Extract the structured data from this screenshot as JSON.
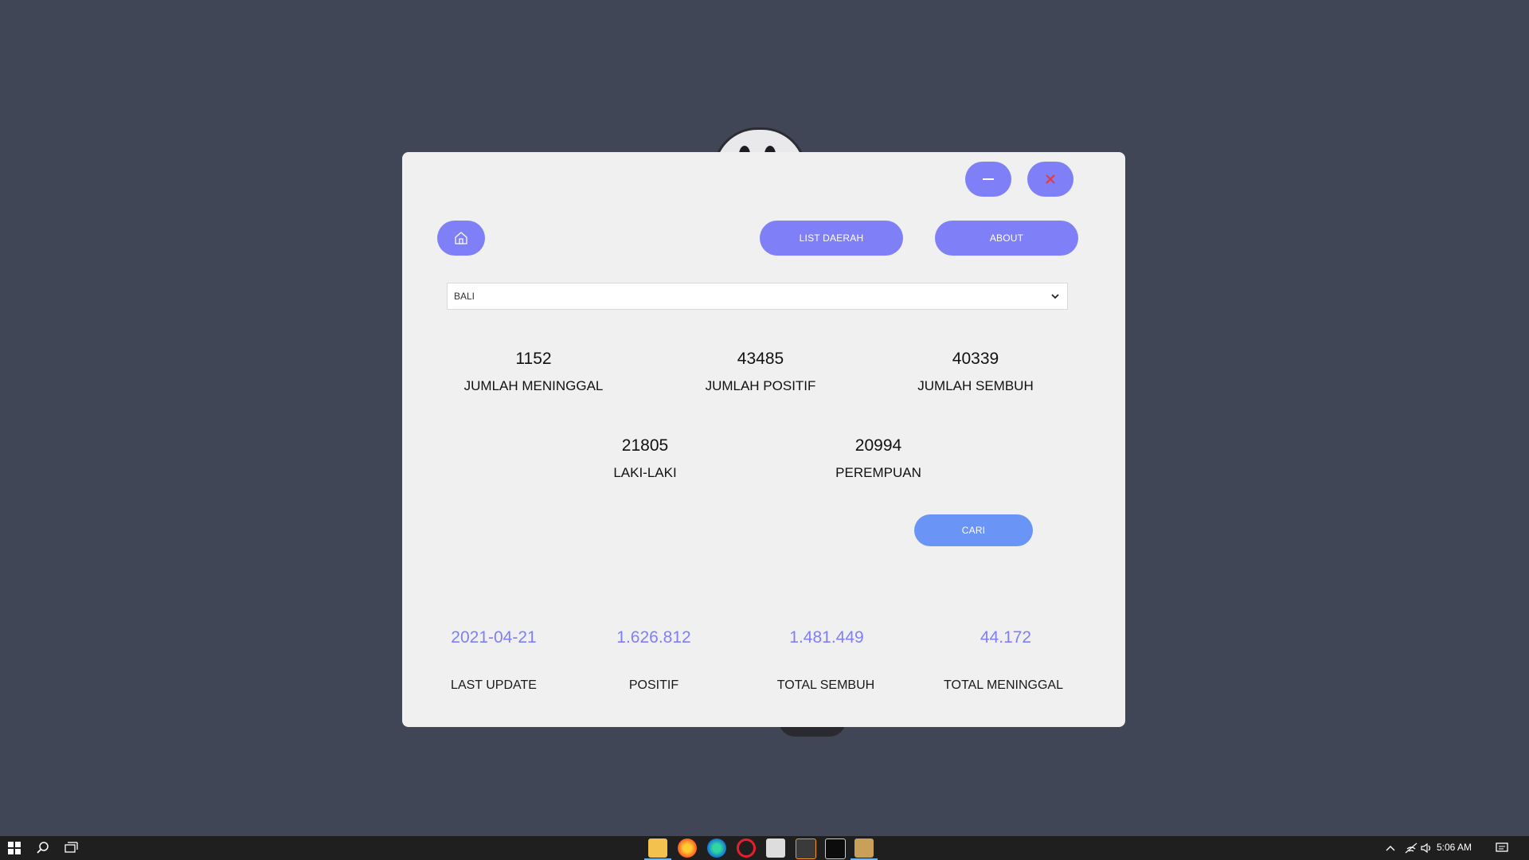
{
  "window": {
    "minimize_label": "—",
    "close_label": "✕",
    "home_icon": "home-icon",
    "nav": {
      "list_daerah": "LIST DAERAH",
      "about": "ABOUT"
    },
    "region_select": {
      "value": "BALI"
    },
    "stats": {
      "meninggal": {
        "value": "1152",
        "label": "JUMLAH MENINGGAL"
      },
      "positif": {
        "value": "43485",
        "label": "JUMLAH POSITIF"
      },
      "sembuh": {
        "value": "40339",
        "label": "JUMLAH SEMBUH"
      },
      "laki": {
        "value": "21805",
        "label": "LAKI-LAKI"
      },
      "perempuan": {
        "value": "20994",
        "label": "PEREMPUAN"
      }
    },
    "cari_label": "CARI",
    "summary": {
      "last_update": {
        "value": "2021-04-21",
        "label": "LAST UPDATE"
      },
      "positif": {
        "value": "1.626.812",
        "label": "POSITIF"
      },
      "total_sembuh": {
        "value": "1.481.449",
        "label": "TOTAL SEMBUH"
      },
      "total_meninggal": {
        "value": "44.172",
        "label": "TOTAL MENINGGAL"
      }
    }
  },
  "colors": {
    "accent": "#7f7ff7",
    "cari_button": "#6b94f7",
    "close_x": "#e8393a",
    "desktop": "#404656"
  },
  "taskbar": {
    "clock": "5:06 AM"
  }
}
